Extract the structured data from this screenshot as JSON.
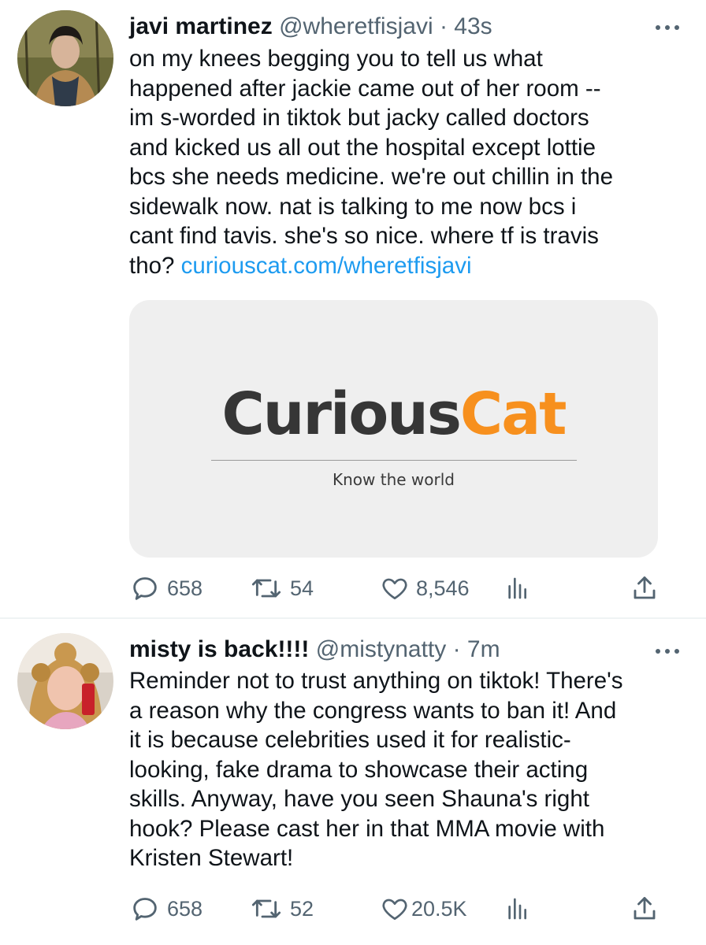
{
  "tweets": [
    {
      "display_name": "javi martinez",
      "handle": "@wheretfisjavi",
      "time": "· 43s",
      "text": "on my knees begging you to tell us what\nhappened after jackie came out of her room --\nim s-worded in tiktok but jacky called doctors\nand kicked us all out the hospital except lottie\nbcs she needs medicine. we're out chillin in the\nsidewalk now. nat is talking to me now bcs i\ncant find tavis. she's so nice. where tf is travis\ntho? ",
      "link": "curiouscat.com/wheretfisjavi",
      "card": {
        "logo_dark": "Curious",
        "logo_orange": "Cat",
        "tagline": "Know the world"
      },
      "replies": "658",
      "retweets": "54",
      "likes": "8,546"
    },
    {
      "display_name": "misty is back!!!!",
      "handle": "@mistynatty",
      "time": "· 7m",
      "text": "Reminder not to trust anything on tiktok! There's\na reason why the congress wants to ban it! And\nit is because celebrities used it for realistic-\nlooking, fake drama to showcase their acting\nskills. Anyway, have you seen Shauna's right\nhook? Please cast her in that MMA movie with\nKristen Stewart!",
      "replies": "658",
      "retweets": "52",
      "likes": "20.5K"
    }
  ],
  "icons": {
    "reply": "reply-icon",
    "retweet": "retweet-icon",
    "like": "heart-icon",
    "analytics": "analytics-icon",
    "share": "share-icon",
    "more": "more-icon"
  },
  "colors": {
    "link": "#1d9bf0",
    "secondary_text": "#536471",
    "logo_orange": "#f7901e",
    "logo_dark": "#363636"
  }
}
